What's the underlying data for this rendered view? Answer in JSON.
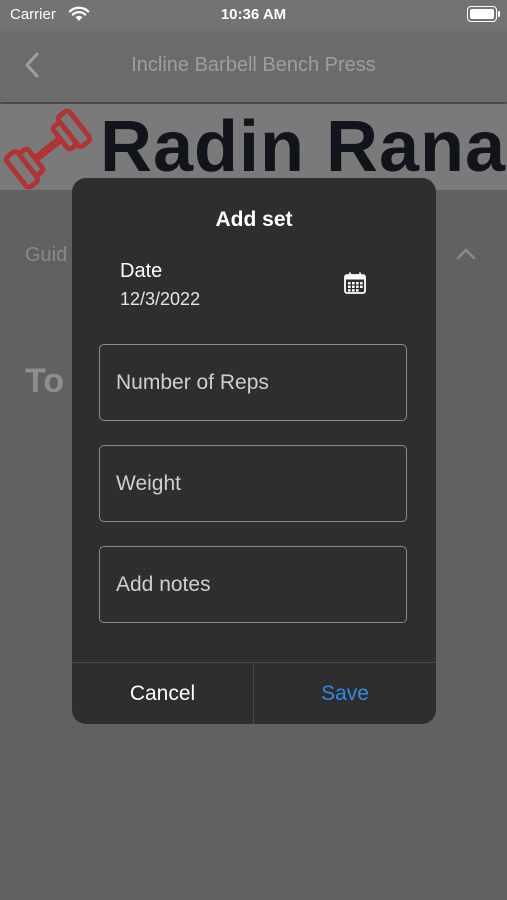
{
  "status_bar": {
    "carrier": "Carrier",
    "time": "10:36 AM"
  },
  "nav": {
    "title": "Incline Barbell Bench Press",
    "back_icon": "chevron-left-icon"
  },
  "banner": {
    "brand": "Radin Rana",
    "logo_icon": "dumbbell-icon",
    "logo_color": "#d32f2f"
  },
  "background": {
    "guide_label": "Guid",
    "chevron_icon": "chevron-up-icon",
    "heading_fragment": "To"
  },
  "dialog": {
    "title": "Add set",
    "date_label": "Date",
    "date_value": "12/3/2022",
    "calendar_icon": "calendar-icon",
    "fields": {
      "reps_placeholder": "Number of Reps",
      "weight_placeholder": "Weight",
      "notes_placeholder": "Add notes"
    },
    "cancel_label": "Cancel",
    "save_label": "Save",
    "accent_color": "#2f8ae6"
  }
}
